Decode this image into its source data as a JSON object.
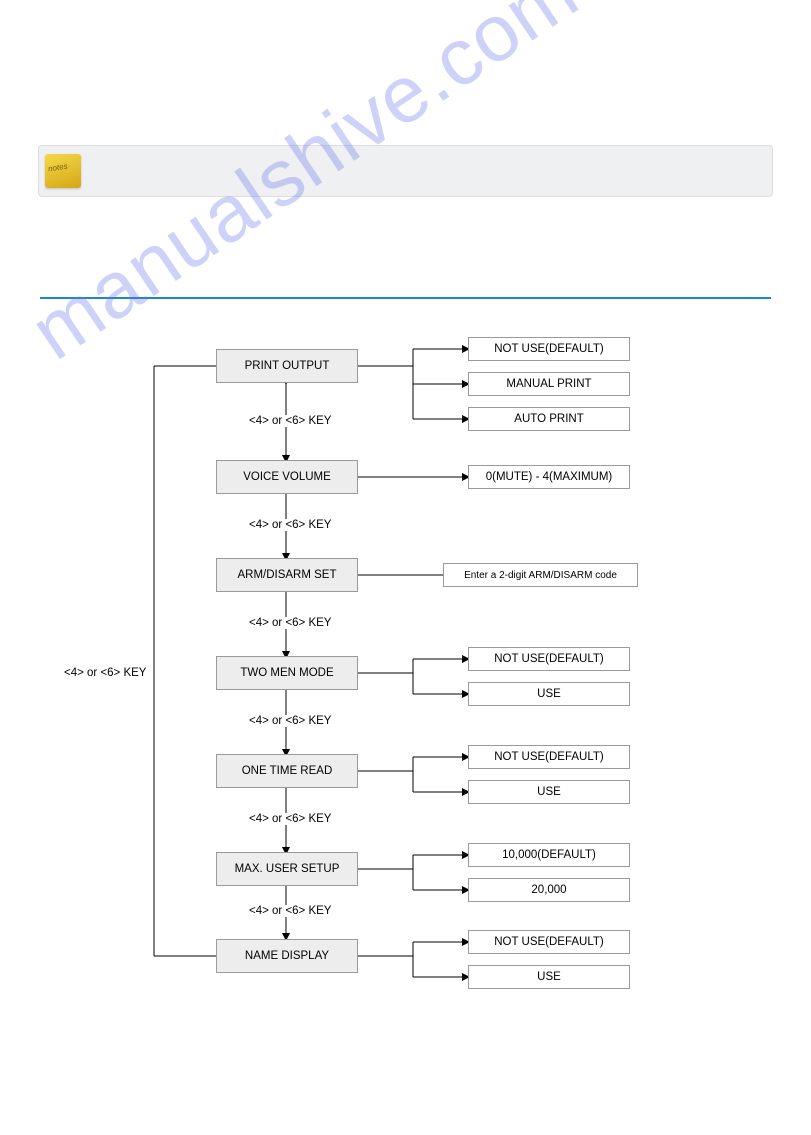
{
  "sideLabel": "<4> or <6> KEY",
  "rows": [
    {
      "main": "PRINT OUTPUT",
      "nav": "<4> or <6> KEY",
      "opts": [
        "NOT USE(DEFAULT)",
        "MANUAL PRINT",
        "AUTO PRINT"
      ]
    },
    {
      "main": "VOICE VOLUME",
      "nav": "<4> or <6> KEY",
      "opts": [
        "0(MUTE) - 4(MAXIMUM)"
      ]
    },
    {
      "main": "ARM/DISARM SET",
      "nav": "<4> or <6> KEY",
      "opts": [
        "Enter a 2-digit ARM/DISARM code"
      ]
    },
    {
      "main": "TWO MEN MODE",
      "nav": "<4> or <6> KEY",
      "opts": [
        "NOT USE(DEFAULT)",
        "USE"
      ]
    },
    {
      "main": "ONE TIME READ",
      "nav": "<4> or <6> KEY",
      "opts": [
        "NOT USE(DEFAULT)",
        "USE"
      ]
    },
    {
      "main": "MAX. USER SETUP",
      "nav": "<4> or <6> KEY",
      "opts": [
        "10,000(DEFAULT)",
        "20,000"
      ]
    },
    {
      "main": "NAME DISPLAY",
      "nav": "",
      "opts": [
        "NOT USE(DEFAULT)",
        "USE"
      ]
    }
  ],
  "watermark": "manualshive.com"
}
